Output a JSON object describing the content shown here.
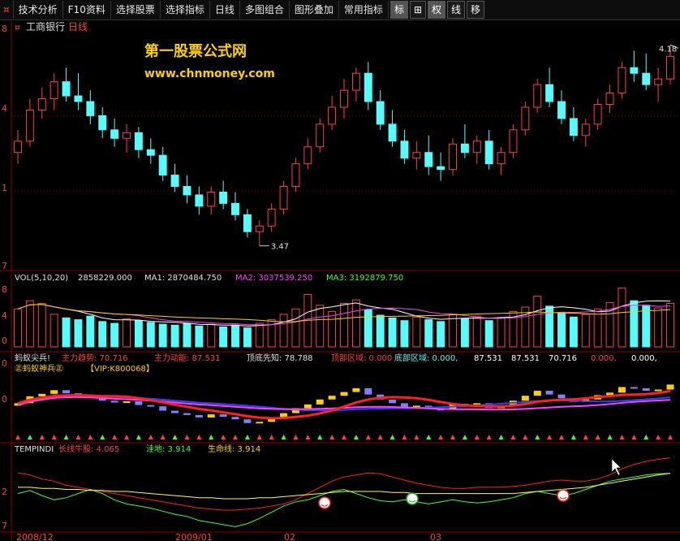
{
  "toolbar": {
    "left_icon": "¤",
    "items": [
      "技术分析",
      "F10资料",
      "选择股票",
      "选择指标",
      "日线",
      "多图组合",
      "图形叠加",
      "常用指标"
    ],
    "right_buttons": [
      "标",
      "⊞",
      "权",
      "线",
      "移"
    ]
  },
  "main": {
    "stock_icon": "¤",
    "stock_name": "工商银行",
    "period": "日线",
    "watermark1": "第一股票公式网",
    "watermark2": "www.chnmoney.com",
    "high_label": "4.18",
    "low_label": "3.47",
    "axis": [
      "8",
      "4",
      "1",
      "7"
    ]
  },
  "vol_panel": {
    "name": "VOL(5,10,20)",
    "value": "2858229.000",
    "ma1_label": "MA1: 2870484.750",
    "ma2_label": "MA2: 3037539.250",
    "ma3_label": "MA3: 3192879.750",
    "axis": [
      "8",
      "4",
      "0"
    ]
  },
  "ant_panel": {
    "name": "蚂蚁尖兵!",
    "l1": "主力趋势: 70.716",
    "l2": "主力动能: 87.531",
    "l3": "顶底先知: 78.788",
    "l4": "顶部区域: 0.000",
    "l5": "底部区域: 0.000,",
    "l6": "87.531",
    "l7": "87.531",
    "l8": "70.716",
    "l9": "0.000,",
    "l10": "0.000,",
    "title2": "㊣蚂蚁神兵㊣",
    "vip": "【VIP:K800068】",
    "axis": [
      "0",
      "0"
    ]
  },
  "temp_panel": {
    "name": "TEMPINDI",
    "l1": "长线牛股: 4.065",
    "l2": "洼地: 3.914",
    "l3": "生命线: 3.914",
    "axis": [
      "2",
      "7"
    ]
  },
  "dates": [
    "2008/12",
    "2009/01",
    "02",
    "03"
  ],
  "chart_data": {
    "type": "candlestick",
    "candles": [
      [
        3.8,
        3.88,
        3.76,
        3.84
      ],
      [
        3.84,
        3.99,
        3.82,
        3.95
      ],
      [
        3.95,
        4.03,
        3.92,
        3.99
      ],
      [
        3.99,
        4.08,
        3.95,
        4.05
      ],
      [
        4.05,
        4.1,
        3.98,
        4.0
      ],
      [
        4.0,
        4.08,
        3.95,
        3.98
      ],
      [
        3.98,
        4.02,
        3.9,
        3.93
      ],
      [
        3.93,
        3.96,
        3.85,
        3.88
      ],
      [
        3.88,
        3.92,
        3.82,
        3.85
      ],
      [
        3.85,
        3.9,
        3.8,
        3.87
      ],
      [
        3.87,
        3.89,
        3.78,
        3.81
      ],
      [
        3.81,
        3.85,
        3.76,
        3.79
      ],
      [
        3.79,
        3.82,
        3.7,
        3.72
      ],
      [
        3.72,
        3.76,
        3.66,
        3.68
      ],
      [
        3.68,
        3.72,
        3.62,
        3.65
      ],
      [
        3.65,
        3.68,
        3.58,
        3.61
      ],
      [
        3.61,
        3.68,
        3.58,
        3.66
      ],
      [
        3.66,
        3.7,
        3.6,
        3.62
      ],
      [
        3.62,
        3.66,
        3.56,
        3.58
      ],
      [
        3.58,
        3.6,
        3.5,
        3.52
      ],
      [
        3.52,
        3.56,
        3.47,
        3.54
      ],
      [
        3.54,
        3.62,
        3.52,
        3.6
      ],
      [
        3.6,
        3.7,
        3.58,
        3.68
      ],
      [
        3.68,
        3.78,
        3.66,
        3.76
      ],
      [
        3.76,
        3.85,
        3.74,
        3.82
      ],
      [
        3.82,
        3.92,
        3.8,
        3.9
      ],
      [
        3.9,
        4.0,
        3.88,
        3.96
      ],
      [
        3.96,
        4.06,
        3.92,
        4.02
      ],
      [
        4.02,
        4.1,
        3.98,
        4.08
      ],
      [
        4.08,
        4.12,
        3.95,
        3.98
      ],
      [
        3.98,
        4.02,
        3.88,
        3.9
      ],
      [
        3.9,
        3.95,
        3.82,
        3.84
      ],
      [
        3.84,
        3.88,
        3.76,
        3.78
      ],
      [
        3.78,
        3.84,
        3.74,
        3.8
      ],
      [
        3.8,
        3.86,
        3.72,
        3.75
      ],
      [
        3.75,
        3.8,
        3.7,
        3.74
      ],
      [
        3.74,
        3.85,
        3.72,
        3.83
      ],
      [
        3.83,
        3.9,
        3.78,
        3.8
      ],
      [
        3.8,
        3.86,
        3.76,
        3.84
      ],
      [
        3.84,
        3.88,
        3.74,
        3.76
      ],
      [
        3.76,
        3.82,
        3.72,
        3.8
      ],
      [
        3.8,
        3.9,
        3.78,
        3.88
      ],
      [
        3.88,
        3.98,
        3.86,
        3.96
      ],
      [
        3.96,
        4.06,
        3.94,
        4.04
      ],
      [
        4.04,
        4.1,
        3.96,
        3.98
      ],
      [
        3.98,
        4.02,
        3.9,
        3.92
      ],
      [
        3.92,
        3.96,
        3.84,
        3.86
      ],
      [
        3.86,
        3.92,
        3.82,
        3.9
      ],
      [
        3.9,
        3.99,
        3.88,
        3.97
      ],
      [
        3.97,
        4.04,
        3.94,
        4.01
      ],
      [
        4.01,
        4.12,
        3.99,
        4.1
      ],
      [
        4.1,
        4.16,
        4.05,
        4.08
      ],
      [
        4.08,
        4.15,
        4.02,
        4.04
      ],
      [
        4.04,
        4.1,
        3.98,
        4.06
      ],
      [
        4.06,
        4.18,
        4.04,
        4.14
      ]
    ],
    "volume": [
      4.2,
      5.1,
      4.8,
      3.6,
      3.2,
      3.0,
      3.4,
      2.8,
      2.6,
      3.1,
      2.9,
      2.7,
      2.5,
      2.4,
      2.6,
      2.3,
      2.5,
      2.2,
      2.4,
      2.1,
      2.6,
      3.0,
      3.6,
      4.2,
      5.8,
      4.6,
      3.9,
      4.8,
      5.2,
      4.1,
      3.5,
      3.2,
      2.9,
      3.3,
      3.0,
      2.8,
      3.6,
      3.1,
      3.4,
      2.9,
      3.2,
      3.9,
      4.4,
      5.6,
      4.5,
      3.8,
      3.3,
      3.6,
      4.2,
      4.9,
      6.5,
      5.1,
      4.6,
      4.3,
      4.8
    ],
    "ylim": [
      3.4,
      4.25
    ],
    "high": 4.18,
    "low": 3.47,
    "temp_red": [
      3.92,
      3.9,
      3.86,
      3.84,
      3.8,
      3.78,
      3.76,
      3.74,
      3.72,
      3.7,
      3.68,
      3.66,
      3.64,
      3.62,
      3.6,
      3.58,
      3.57,
      3.56,
      3.56,
      3.57,
      3.58,
      3.6,
      3.62,
      3.66,
      3.72,
      3.78,
      3.84,
      3.88,
      3.9,
      3.92,
      3.91,
      3.88,
      3.85,
      3.82,
      3.8,
      3.78,
      3.77,
      3.77,
      3.78,
      3.78,
      3.78,
      3.79,
      3.8,
      3.82,
      3.84,
      3.85,
      3.84,
      3.84,
      3.86,
      3.9,
      3.96,
      4.0,
      4.03,
      4.05,
      4.065
    ],
    "temp_green": [
      3.72,
      3.75,
      3.7,
      3.66,
      3.68,
      3.72,
      3.76,
      3.72,
      3.66,
      3.62,
      3.6,
      3.58,
      3.55,
      3.52,
      3.5,
      3.46,
      3.44,
      3.42,
      3.4,
      3.43,
      3.48,
      3.54,
      3.6,
      3.64,
      3.66,
      3.7,
      3.74,
      3.76,
      3.72,
      3.68,
      3.65,
      3.64,
      3.66,
      3.64,
      3.62,
      3.64,
      3.66,
      3.64,
      3.63,
      3.64,
      3.66,
      3.68,
      3.72,
      3.74,
      3.72,
      3.7,
      3.72,
      3.76,
      3.8,
      3.84,
      3.86,
      3.88,
      3.9,
      3.91,
      3.914
    ],
    "temp_yellow": [
      3.78,
      3.78,
      3.77,
      3.77,
      3.76,
      3.76,
      3.75,
      3.75,
      3.74,
      3.74,
      3.73,
      3.72,
      3.71,
      3.7,
      3.69,
      3.68,
      3.68,
      3.67,
      3.67,
      3.67,
      3.68,
      3.68,
      3.69,
      3.7,
      3.71,
      3.72,
      3.73,
      3.74,
      3.74,
      3.74,
      3.74,
      3.73,
      3.73,
      3.72,
      3.72,
      3.72,
      3.72,
      3.72,
      3.72,
      3.72,
      3.72,
      3.72,
      3.73,
      3.74,
      3.75,
      3.76,
      3.77,
      3.78,
      3.8,
      3.82,
      3.84,
      3.86,
      3.88,
      3.9,
      3.914
    ]
  },
  "colors": {
    "up": "#ff4040",
    "down": "#54fcfc",
    "grid": "#8b0000",
    "ma1": "#ffffff",
    "ma2": "#ff40ff",
    "ma3": "#40ff40"
  }
}
